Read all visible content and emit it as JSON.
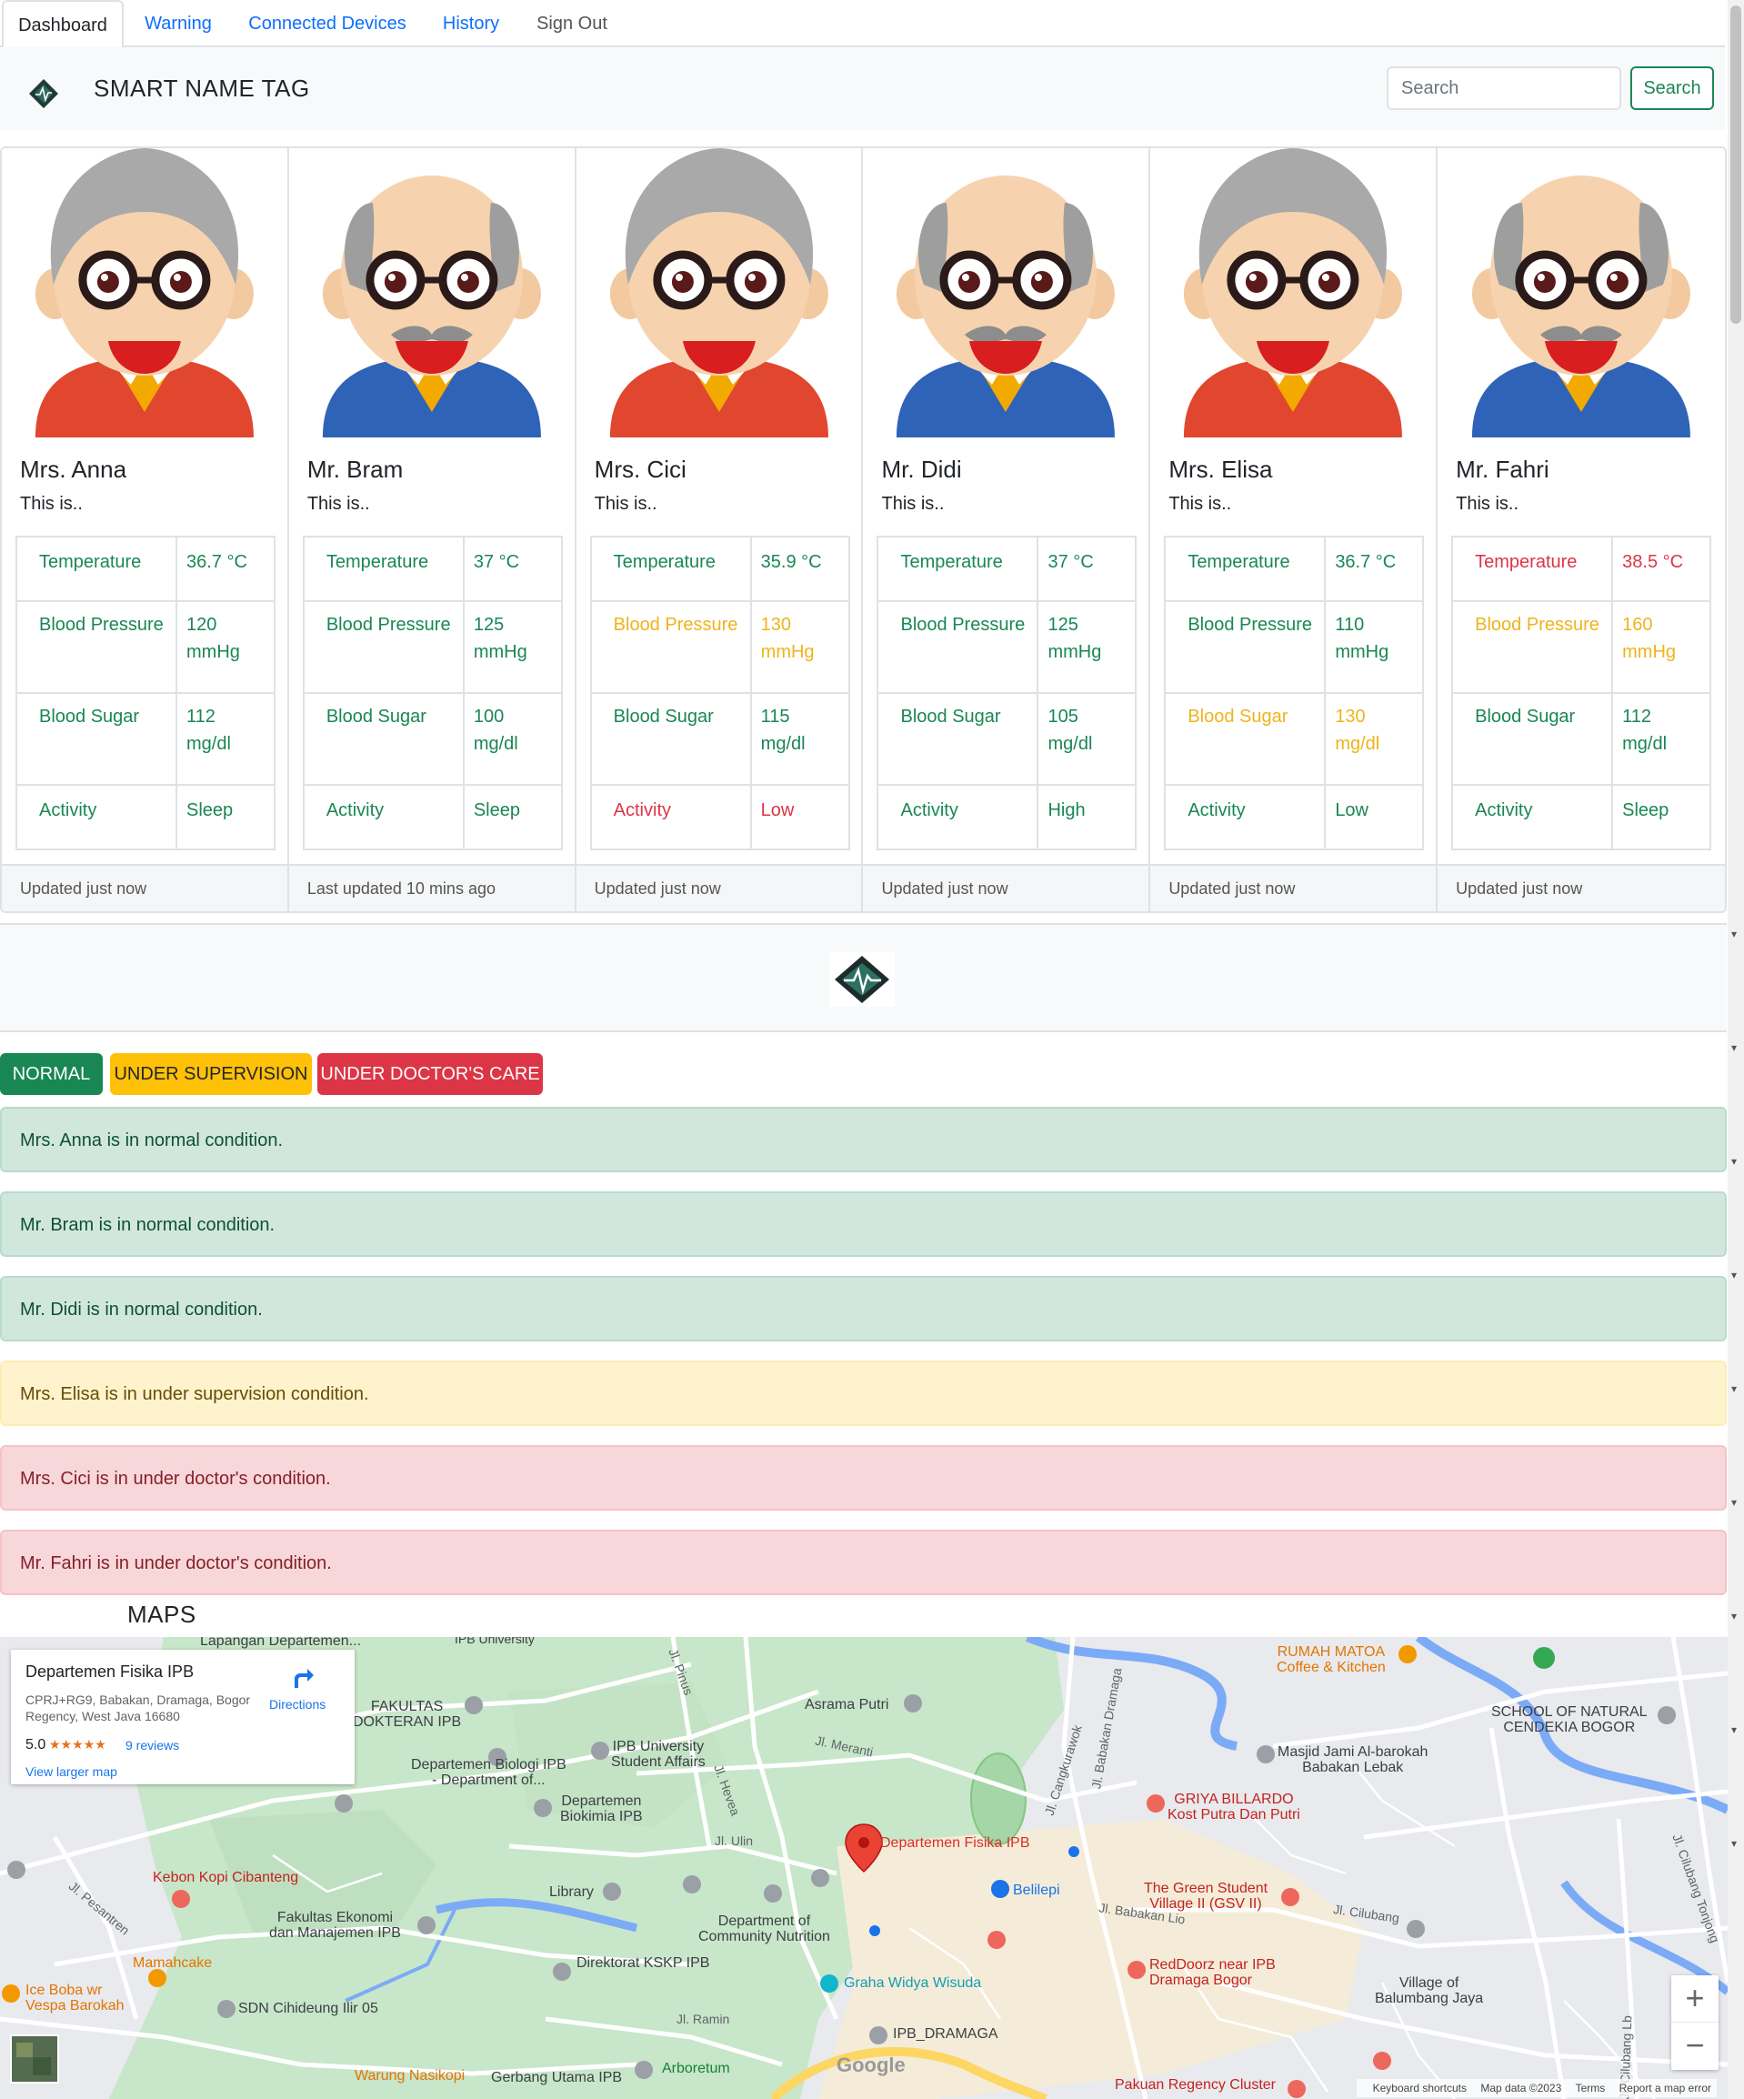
{
  "tabs": [
    {
      "label": "Dashboard",
      "active": true
    },
    {
      "label": "Warning"
    },
    {
      "label": "Connected Devices"
    },
    {
      "label": "History"
    },
    {
      "label": "Sign Out"
    }
  ],
  "navbar": {
    "brand": "SMART NAME TAG",
    "search_placeholder": "Search",
    "search_button": "Search"
  },
  "colors": {
    "normal": "#198754",
    "supervision": "#f0b31c",
    "doctor": "#dc3545"
  },
  "vital_labels": {
    "temperature": "Temperature",
    "blood_pressure": "Blood Pressure",
    "blood_sugar": "Blood Sugar",
    "activity": "Activity"
  },
  "patients": [
    {
      "name": "Mrs. Anna",
      "text": "This is..",
      "temperature": "36.7 °C",
      "blood_pressure": "120 mmHg",
      "blood_sugar": "112 mg/dl",
      "activity": "Sleep",
      "footer": "Updated just now"
    },
    {
      "name": "Mr. Bram",
      "text": "This is..",
      "temperature": "37 °C",
      "blood_pressure": "125 mmHg",
      "blood_sugar": "100 mg/dl",
      "activity": "Sleep",
      "footer": "Last updated 10 mins ago"
    },
    {
      "name": "Mrs. Cici",
      "text": "This is..",
      "temperature": "35.9 °C",
      "blood_pressure": "130 mmHg",
      "blood_sugar": "115 mg/dl",
      "activity": "Low",
      "footer": "Updated just now"
    },
    {
      "name": "Mr. Didi",
      "text": "This is..",
      "temperature": "37 °C",
      "blood_pressure": "125 mmHg",
      "blood_sugar": "105 mg/dl",
      "activity": "High",
      "footer": "Updated just now"
    },
    {
      "name": "Mrs. Elisa",
      "text": "This is..",
      "temperature": "36.7 °C",
      "blood_pressure": "110 mmHg",
      "blood_sugar": "130 mg/dl",
      "activity": "Low",
      "footer": "Updated just now"
    },
    {
      "name": "Mr. Fahri",
      "text": "This is..",
      "temperature": "38.5 °C",
      "blood_pressure": "160 mmHg",
      "blood_sugar": "112 mg/dl",
      "activity": "Sleep",
      "footer": "Updated just now"
    }
  ],
  "status_buttons": {
    "normal": "NORMAL",
    "supervision": "UNDER SUPERVISION",
    "doctor": "UNDER DOCTOR'S CARE"
  },
  "alerts": [
    {
      "text": "Mrs. Anna is in normal condition.",
      "level": "normal"
    },
    {
      "text": "Mr. Bram is in normal condition.",
      "level": "normal"
    },
    {
      "text": "Mr. Didi is in normal condition.",
      "level": "normal"
    },
    {
      "text": "Mrs. Elisa is in under supervision condition.",
      "level": "supervision"
    },
    {
      "text": "Mrs. Cici is in under doctor's condition.",
      "level": "doctor"
    },
    {
      "text": "Mr. Fahri is in under doctor's condition.",
      "level": "doctor"
    }
  ],
  "maps": {
    "title": "MAPS",
    "place": {
      "name": "Departemen Fisika IPB",
      "address": "CPRJ+RG9, Babakan, Dramaga, Bogor Regency, West Java 16680",
      "rating": "5.0",
      "stars": "★★★★★",
      "reviews": "9 reviews",
      "larger_map": "View larger map",
      "directions": "Directions"
    },
    "zoom_in": "+",
    "zoom_out": "−",
    "google": "Google",
    "attribution": {
      "shortcuts": "Keyboard shortcuts",
      "data": "Map data ©2023",
      "terms": "Terms",
      "report": "Report a map error"
    },
    "labels": {
      "fisika": "Departemen Fisika IPB",
      "lapangan": "Lapangan Departemen...",
      "rumah_matoa": "RUMAH MATOA\nCoffee & Kitchen",
      "school_nat": "SCHOOL OF NATURAL\nCENDEKIA BOGOR",
      "fakultas_kedokteran": "FAKULTAS\nDOKTERAN IPB",
      "asrama_putri": "Asrama Putri",
      "student_affairs": "IPB University\nStudent Affairs",
      "biologi": "Departemen Biologi IPB\n- Department of...",
      "biokimia": "Departemen\nBiokimia IPB",
      "masjid": "Masjid Jami Al-barokah\nBabakan Lebak",
      "griya": "GRIYA BILLARDO\nKost Putra Dan Putri",
      "kebon_kopi": "Kebon Kopi Cibanteng",
      "library": "Library",
      "community_nutrition": "Department of\nCommunity Nutrition",
      "belilepi": "Belilepi",
      "green_student": "The Green Student\nVillage II (GSV II)",
      "fakultas_ekonomi": "Fakultas Ekonomi\ndan Manajemen IPB",
      "mamahcake": "Mamahcake",
      "ice_boba": "Ice Boba wr\nVespa Barokah",
      "sdn": "SDN Cihideung Ilir 05",
      "kskp": "Direktorat KSKP IPB",
      "graha": "Graha Widya Wisuda",
      "reddoorz": "RedDoorz near IPB\nDramaga Bogor",
      "village_balumbang": "Village of\nBalumbang Jaya",
      "ipb_dramaga": "IPB_DRAMAGA",
      "arboretum": "Arboretum",
      "warung": "Warung Nasikopi",
      "gerbang": "Gerbang Utama IPB",
      "pakuan": "Pakuan Regency Cluster",
      "ulin": "Jl. Ulin",
      "ramin": "Jl. Ramin",
      "meranti": "Jl. Meranti",
      "pinus": "Jl. Pinus",
      "babakan_lio": "Jl. Babakan Lio",
      "cilubang": "Jl. Cilubang",
      "cangkurawok": "Jl. Cangkurawok",
      "babakan_dramaga": "Jl. Babakan Dramaga",
      "pesantren": "Jl. Pesantren",
      "univ": "IPB University",
      "hevea": "Jl. Hevea",
      "cilubang_tonjong": "Jl. Cilubang Tonjong",
      "cilubang_lb": "Jl. Cilubang Lb"
    }
  }
}
